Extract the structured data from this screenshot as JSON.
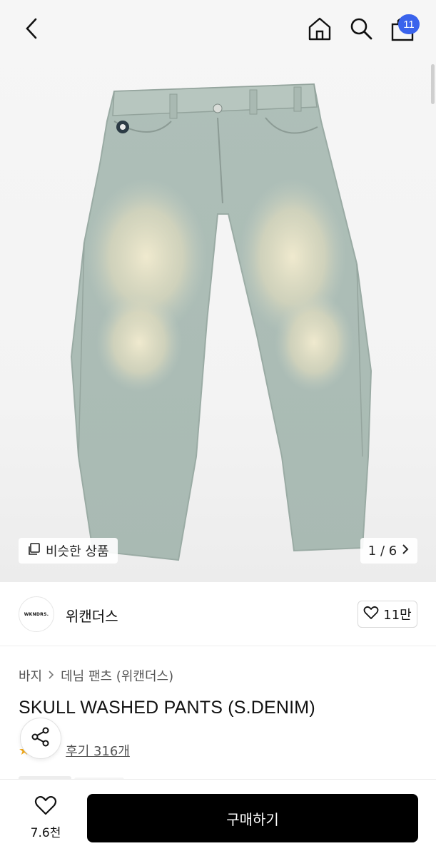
{
  "header": {
    "back_icon": "chevron-left-icon",
    "home_icon": "home-icon",
    "search_icon": "search-icon",
    "bag_icon": "shopping-bag-icon",
    "cart_count": "11",
    "badge_color": "#3a63ec"
  },
  "hero": {
    "image_subject": "washed denim pants",
    "similar_label": "비슷한 상품",
    "similar_icon": "copy-icon",
    "pagination": "1 / 6",
    "next_icon": "chevron-right-icon"
  },
  "brand": {
    "logo_text": "WKNDRS.",
    "name": "위캔더스",
    "like_count": "11만",
    "like_icon": "heart-icon"
  },
  "product": {
    "breadcrumb": [
      "바지",
      "데님 팬츠 (위캔더스)"
    ],
    "title": "SKULL WASHED PANTS (S.DENIM)",
    "review_link": "후기 316개",
    "share_icon": "share-icon"
  },
  "bottom_bar": {
    "wish_count": "7.6천",
    "buy_label": "구매하기",
    "buy_color": "#000000"
  }
}
